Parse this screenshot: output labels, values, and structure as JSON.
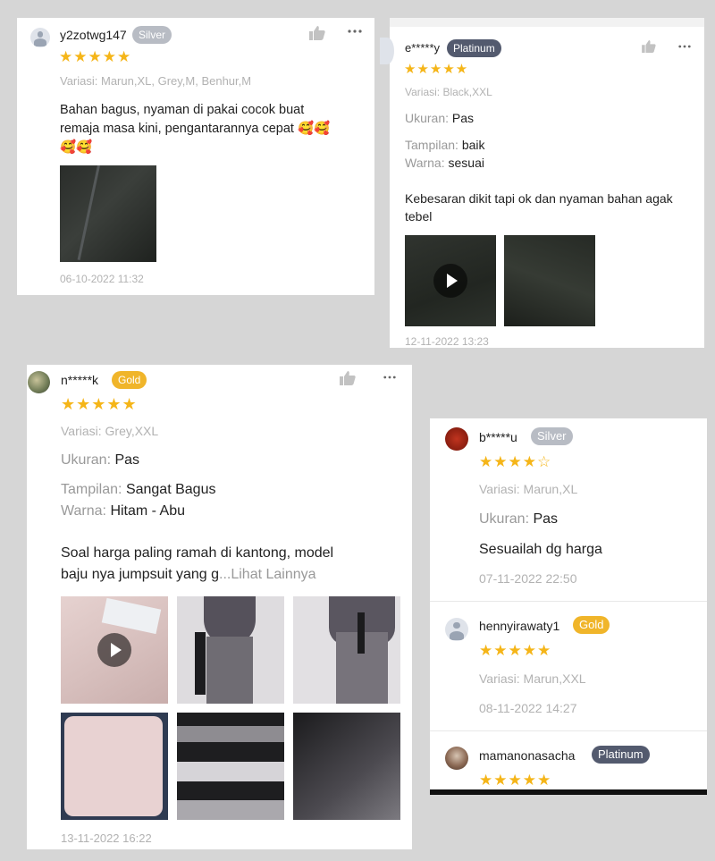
{
  "colors": {
    "star": "#f5b518",
    "gold": "#f0b52a",
    "silver": "#b8bcc4",
    "platinum": "#535a6e"
  },
  "reviews": [
    {
      "user": "y2zotwg147",
      "badge": "Silver",
      "rating": 5,
      "variant": "Variasi: Marun,XL, Grey,M, Benhur,M",
      "text_line1": "Bahan bagus, nyaman di pakai cocok buat",
      "text_line2": "remaja masa kini, pengantarannya cepat 🥰🥰",
      "text_line3": "🥰🥰",
      "date": "06-10-2022 11:32"
    },
    {
      "user": "e*****y",
      "badge": "Platinum",
      "rating": 5,
      "variant": "Variasi: Black,XXL",
      "ukuran_label": "Ukuran:",
      "ukuran_value": "Pas",
      "tampilan_label": "Tampilan:",
      "tampilan_value": "baik",
      "warna_label": "Warna:",
      "warna_value": "sesuai",
      "text_line1": "Kebesaran dikit tapi ok dan nyaman bahan agak",
      "text_line2": "tebel",
      "date": "12-11-2022 13:23"
    },
    {
      "user": "n*****k",
      "badge": "Gold",
      "rating": 5,
      "variant": "Variasi: Grey,XXL",
      "ukuran_label": "Ukuran:",
      "ukuran_value": "Pas",
      "tampilan_label": "Tampilan:",
      "tampilan_value": "Sangat Bagus",
      "warna_label": "Warna:",
      "warna_value": "Hitam - Abu",
      "text_line1": "Soal harga paling ramah di kantong, model",
      "text_line2": " baju nya jumpsuit yang g",
      "more_link": "...Lihat Lainnya",
      "date": "13-11-2022 16:22"
    },
    {
      "user": "b*****u",
      "badge": "Silver",
      "rating": 4,
      "variant": "Variasi: Marun,XL",
      "ukuran_label": "Ukuran:",
      "ukuran_value": "Pas",
      "text_line1": "Sesuailah dg harga",
      "date": "07-11-2022 22:50"
    },
    {
      "user": "hennyirawaty1",
      "badge": "Gold",
      "rating": 5,
      "variant": "Variasi: Marun,XXL",
      "date": "08-11-2022 14:27"
    },
    {
      "user": "mamanonasacha",
      "badge": "Platinum",
      "rating": 5
    }
  ],
  "icons": {
    "like": "thumbs-up-icon",
    "more": "more-horizontal-icon",
    "play": "play-icon"
  }
}
